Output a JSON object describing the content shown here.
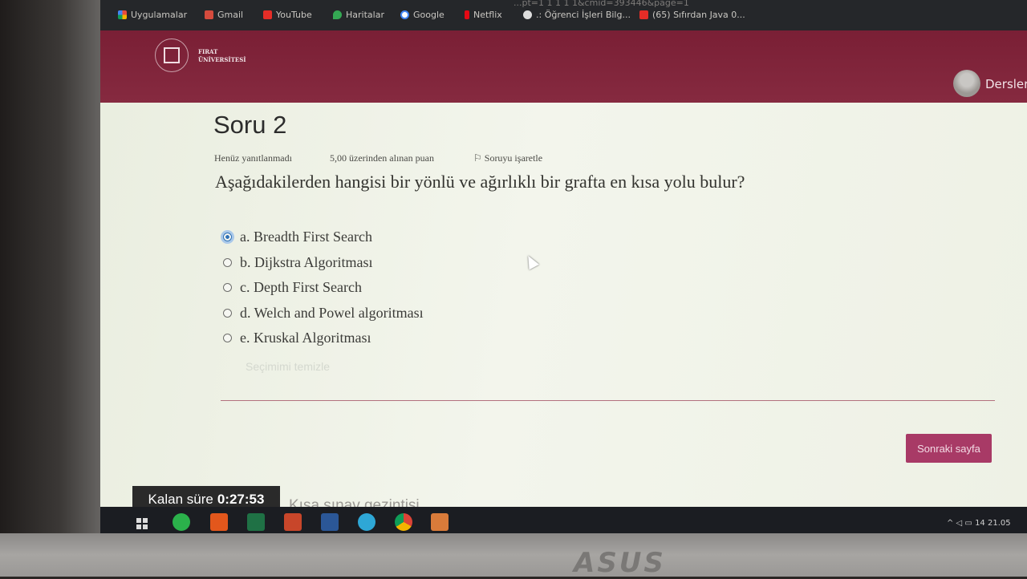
{
  "browser": {
    "url_fragment": "...pt=1 1 1 1 1&cmid=393446&page=1",
    "bookmarks": [
      {
        "label": "Uygulamalar",
        "icon": "apps-grid-icon"
      },
      {
        "label": "Gmail",
        "icon": "gmail-icon"
      },
      {
        "label": "YouTube",
        "icon": "youtube-icon"
      },
      {
        "label": "Haritalar",
        "icon": "maps-icon"
      },
      {
        "label": "Google",
        "icon": "google-icon"
      },
      {
        "label": "Netflix",
        "icon": "netflix-icon"
      },
      {
        "label": ".: Öğrenci İşleri Bilg...",
        "icon": "globe-icon"
      },
      {
        "label": "(65) Sıfırdan Java 0...",
        "icon": "youtube-icon"
      }
    ]
  },
  "header": {
    "logo_line1": "FIRAT",
    "logo_line2": "ÜNİVERSİTESİ",
    "user_menu_label": "Dersler"
  },
  "question": {
    "title": "Soru 2",
    "status": "Henüz yanıtlanmadı",
    "grade": "5,00 üzerinden alınan puan",
    "flag_label": "Soruyu işaretle",
    "text": "Aşağıdakilerden hangisi bir yönlü ve ağırlıklı bir grafta en kısa yolu bulur?",
    "options": [
      {
        "label": "a. Breadth First Search",
        "selected": true
      },
      {
        "label": "b. Dijkstra Algoritması",
        "selected": false
      },
      {
        "label": "c. Depth First Search",
        "selected": false
      },
      {
        "label": "d. Welch and Powel algoritması",
        "selected": false
      },
      {
        "label": "e. Kruskal Algoritması",
        "selected": false
      }
    ],
    "clear_label": "Seçimimi temizle"
  },
  "navigation": {
    "next_label": "Sonraki sayfa",
    "quiz_nav_label": "Kısa sınav gezintisi"
  },
  "timer": {
    "label": "Kalan süre",
    "value": "0:27:53"
  },
  "taskbar": {
    "apps": [
      "windows-start-icon",
      "whatsapp-icon",
      "office-icon",
      "excel-icon",
      "powerpoint-icon",
      "word-icon",
      "edge-icon",
      "chrome-icon",
      "snip-icon"
    ],
    "tray_time": "14",
    "tray_date": "21.05"
  },
  "laptop_brand": "ASUS",
  "colors": {
    "header_maroon": "#7a1f35",
    "next_button": "#a83a66",
    "radio_selected": "#2d6fb5"
  }
}
